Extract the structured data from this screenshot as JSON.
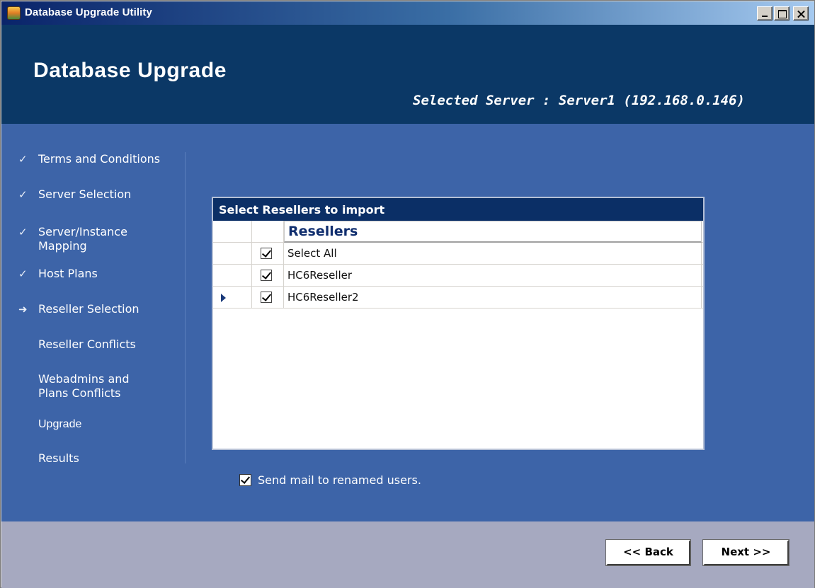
{
  "window": {
    "title": "Database Upgrade Utility",
    "controls": [
      "minimize",
      "maximize",
      "close"
    ]
  },
  "header": {
    "title": "Database Upgrade",
    "server_label": "Selected Server : Server1 (192.168.0.146)"
  },
  "steps": [
    {
      "label": "Terms and Conditions",
      "status": "done",
      "mark": "✓"
    },
    {
      "label": "Server Selection",
      "status": "done",
      "mark": "✓"
    },
    {
      "label": "Server/Instance Mapping",
      "status": "done",
      "mark": "✓"
    },
    {
      "label": "Host Plans",
      "status": "done",
      "mark": "✓"
    },
    {
      "label": "Reseller Selection",
      "status": "current",
      "mark": "➜"
    },
    {
      "label": "Reseller Conflicts",
      "status": "pending",
      "mark": ""
    },
    {
      "label": "Webadmins and Plans Conflicts",
      "status": "pending",
      "mark": ""
    },
    {
      "label": "Upgrade",
      "status": "pending",
      "mark": ""
    },
    {
      "label": "Results",
      "status": "pending",
      "mark": ""
    }
  ],
  "resellers_panel": {
    "title": "Select Resellers to import",
    "column_header": "Resellers",
    "rows": [
      {
        "name": "Select All",
        "checked": true,
        "current": false
      },
      {
        "name": "HC6Reseller",
        "checked": true,
        "current": false
      },
      {
        "name": "HC6Reseller2",
        "checked": true,
        "current": true
      }
    ]
  },
  "options": {
    "send_mail_label": "Send mail to renamed users.",
    "send_mail_checked": true
  },
  "buttons": {
    "back": "<< Back",
    "next": "Next >>"
  },
  "colors": {
    "header_bg": "#0b3866",
    "main_bg": "#3d64a8",
    "footer_bg": "#a6a9c0",
    "panel_header_bg": "#0b2f66"
  }
}
